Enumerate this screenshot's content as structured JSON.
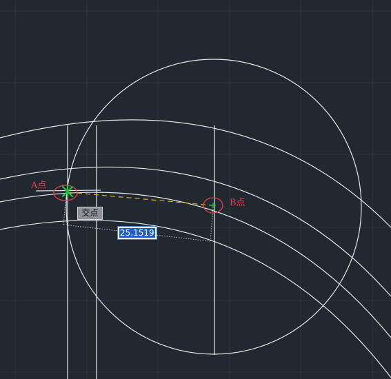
{
  "labels": {
    "point_a": "A点",
    "point_b": "B点"
  },
  "tooltip": {
    "snap_text": "交点"
  },
  "dynamic_input": {
    "value": "25.1519"
  },
  "colors": {
    "background": "#212830",
    "grid": "#2c3440",
    "geometry": "#e6e8ec",
    "marker": "#e0414a",
    "snap": "#22c23a",
    "rubber_band": "#d4a520",
    "tracking": "#bfc3c8"
  },
  "icons": {
    "snap_marker": "intersection-snap-icon"
  }
}
